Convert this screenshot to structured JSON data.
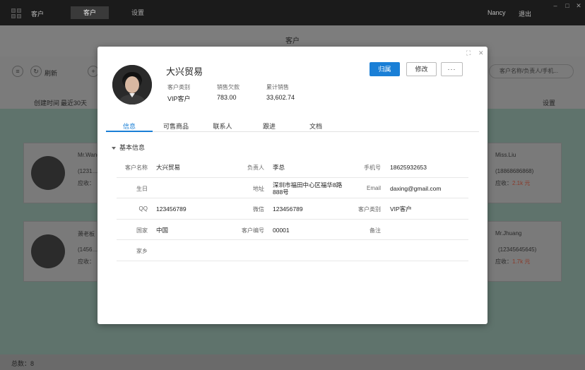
{
  "app": {
    "name": "客户",
    "nav_tabs": [
      {
        "label": "客户"
      },
      {
        "label": "设置"
      }
    ],
    "user": "Nancy",
    "logout": "退出"
  },
  "background": {
    "page_title": "客户",
    "refresh": "刷新",
    "search_placeholder": "客户名称/负责人/手机...",
    "filter_time": "创建时间",
    "filter_range": "最近30天",
    "settings": "设置",
    "total": "总数：8",
    "cards": [
      {
        "name": "Mr.Wang",
        "phone": "(1231…",
        "label": "应收："
      },
      {
        "name": "萧老板",
        "phone": "(1456…",
        "label": "应收："
      },
      {
        "name": "Miss.Liu",
        "phone": "(18868686868)",
        "label": "应收：",
        "amount": "2.1k 元"
      },
      {
        "name": "Mr.Jhuang",
        "phone": "(12345645645)",
        "label": "应收：",
        "amount": "1.7k 元"
      }
    ]
  },
  "modal": {
    "customer_name": "大兴贸易",
    "stats": [
      {
        "label": "客户类别",
        "value": "VIP客户"
      },
      {
        "label": "销售欠款",
        "value": "783.00"
      },
      {
        "label": "累计销售",
        "value": "33,602.74"
      }
    ],
    "buttons": {
      "assign": "归属",
      "edit": "修改",
      "more": "···"
    },
    "tabs": [
      {
        "label": "信息"
      },
      {
        "label": "可售商品"
      },
      {
        "label": "联系人"
      },
      {
        "label": "跟进"
      },
      {
        "label": "文档"
      }
    ],
    "section_title": "基本信息",
    "fields": [
      [
        {
          "label": "客户名称",
          "value": "大兴贸易"
        },
        {
          "label": "负责人",
          "value": "李总"
        },
        {
          "label": "手机号",
          "value": "18625932653"
        }
      ],
      [
        {
          "label": "生日",
          "value": ""
        },
        {
          "label": "地址",
          "value": "深圳市福田中心区福华8路888号"
        },
        {
          "label": "Email",
          "value": "daxing@gmail.com"
        }
      ],
      [
        {
          "label": "QQ",
          "value": "123456789"
        },
        {
          "label": "微信",
          "value": "123456789"
        },
        {
          "label": "客户类别",
          "value": "VIP客户"
        }
      ],
      [
        {
          "label": "国家",
          "value": "中国"
        },
        {
          "label": "客户编号",
          "value": "00001"
        },
        {
          "label": "备注",
          "value": ""
        }
      ],
      [
        {
          "label": "家乡",
          "value": ""
        }
      ]
    ]
  },
  "colors": {
    "accent": "#1a7fd6",
    "amount": "#e05a3a"
  }
}
